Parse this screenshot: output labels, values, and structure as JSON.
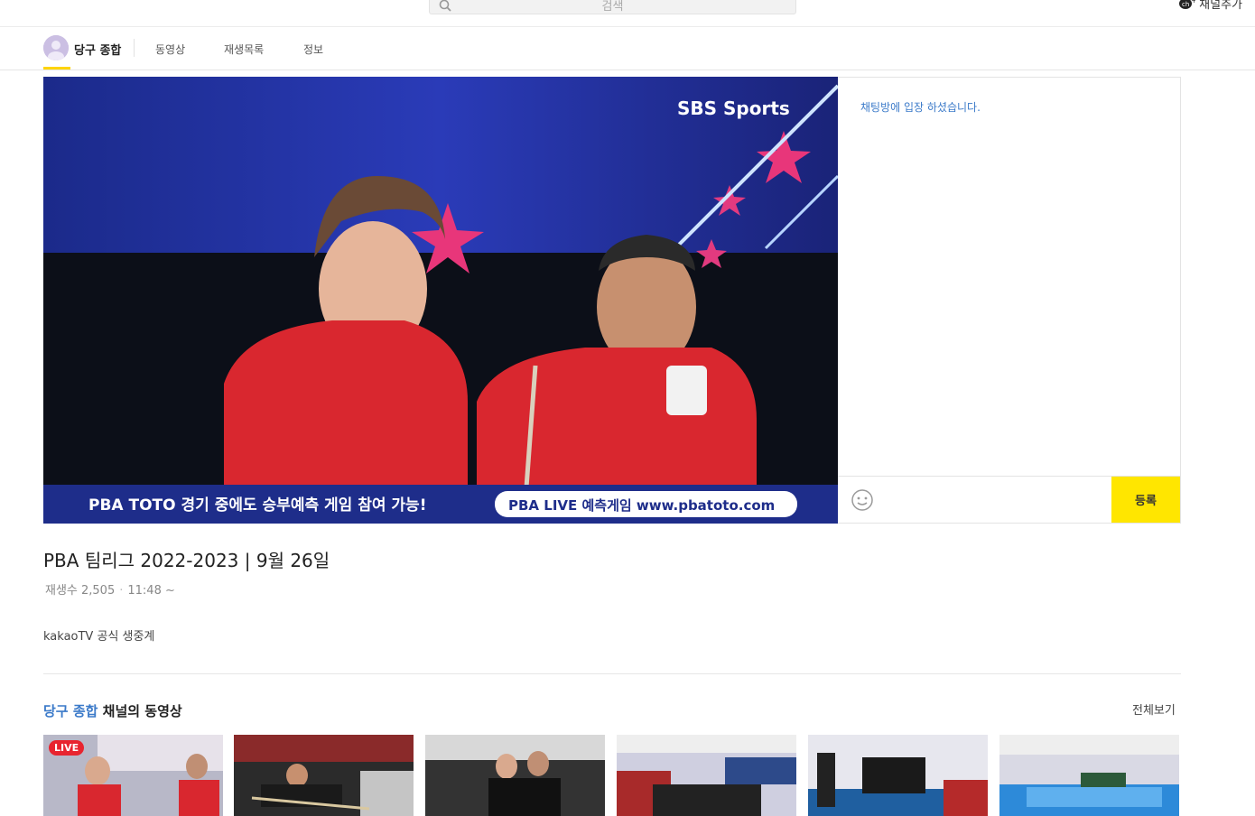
{
  "top": {
    "search_placeholder": "검색",
    "add_channel_label": "채널추가"
  },
  "channel_nav": {
    "channel_name": "당구 종합",
    "tabs": [
      "동영상",
      "재생목록",
      "정보"
    ]
  },
  "player": {
    "broadcaster_logo": "SBS Sports",
    "banner_left": "PBA TOTO  경기 중에도 승부예측 게임 참여 가능!",
    "banner_right": "PBA LIVE 예측게임 www.pbatoto.com"
  },
  "chat": {
    "system_message": "채팅방에 입장 하셨습니다.",
    "input_placeholder": "",
    "send_label": "등록"
  },
  "video": {
    "title": "PBA 팀리그 2022-2023 | 9월 26일",
    "views": "재생수 2,505",
    "time": "11:48 ~",
    "description": "kakaoTV 공식 생중계"
  },
  "section": {
    "channel_highlight": "당구 종합",
    "title_suffix": " 채널의 동영상",
    "see_all": "전체보기",
    "live_badge": "LIVE"
  },
  "colors": {
    "accent_yellow": "#ffe600",
    "link_blue": "#3b7ac9",
    "live_red": "#e8242f"
  }
}
